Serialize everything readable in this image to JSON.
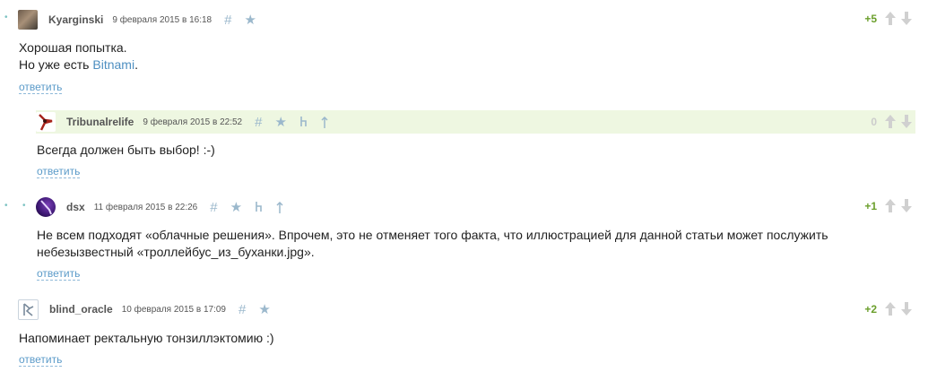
{
  "comments": [
    {
      "user": "Kyarginski",
      "time": "9 февраля 2015 в 16:18",
      "score": "+5",
      "text_line1": "Хорошая попытка.",
      "text_line2_prefix": "Но уже есть ",
      "text_line2_link": "Bitnami",
      "text_line2_suffix": ".",
      "reply": "ответить"
    },
    {
      "user": "Tribunalrelife",
      "time": "9 февраля 2015 в 22:52",
      "score": "0",
      "text": "Всегда должен быть выбор! :-)",
      "reply": "ответить"
    },
    {
      "user": "dsx",
      "time": "11 февраля 2015 в 22:26",
      "score": "+1",
      "text_line1": "Не всем подходят «облачные решения». Впрочем, это не отменяет того факта, что иллюстрацией для данной статьи может послужить",
      "text_line2": "небезызвестный «троллейбус_из_буханки.jpg».",
      "reply": "ответить"
    },
    {
      "user": "blind_oracle",
      "time": "10 февраля 2015 в 17:09",
      "score": "+2",
      "text": "Напоминает ректальную тонзиллэктомию :)",
      "reply": "ответить"
    }
  ],
  "icons": {
    "hash": "hash-icon",
    "favorite": "star-icon",
    "parent": "parent-link-icon",
    "root": "up-arrow-icon",
    "vote_up": "vote-up-icon",
    "vote_down": "vote-down-icon"
  },
  "colors": {
    "positive_score": "#6b9f2c",
    "zero_score": "#cccccc",
    "link": "#5b9bc9",
    "tool_icon": "#9bb8cc",
    "highlight_bg": "#eef7e1"
  }
}
